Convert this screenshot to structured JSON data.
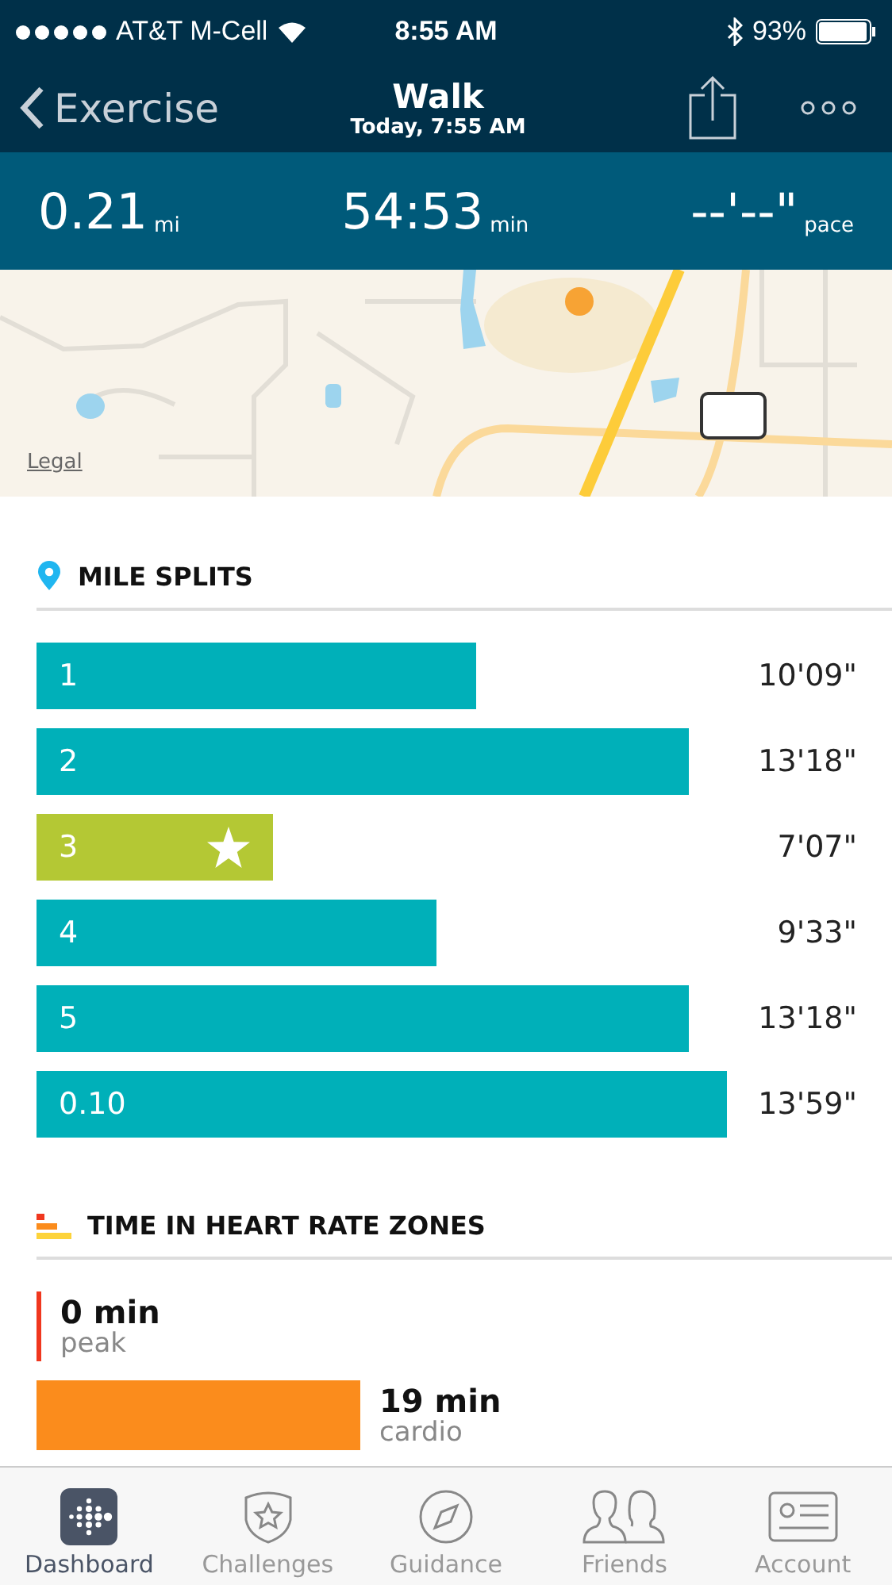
{
  "status_bar": {
    "carrier": "AT&T M-Cell",
    "time": "8:55 AM",
    "battery": "93%"
  },
  "nav": {
    "back": "Exercise",
    "title": "Walk",
    "subtitle": "Today, 7:55 AM"
  },
  "stats": [
    {
      "value": "0.21",
      "unit": "mi"
    },
    {
      "value": "54:53",
      "unit": "min"
    },
    {
      "value": "--'--\"",
      "unit": "pace"
    }
  ],
  "map": {
    "kind": "picture",
    "legal": "Legal"
  },
  "splits": {
    "title": "MILE SPLITS",
    "rows": [
      {
        "label": "1",
        "time": "10'09\"",
        "best": false
      },
      {
        "label": "2",
        "time": "13'18\"",
        "best": false
      },
      {
        "label": "3",
        "time": "7'07\"",
        "best": true
      },
      {
        "label": "4",
        "time": "9'33\"",
        "best": false
      },
      {
        "label": "5",
        "time": "13'18\"",
        "best": false
      },
      {
        "label": "0.10",
        "time": "13'59\"",
        "best": false
      }
    ]
  },
  "heart_zones": {
    "title": "TIME IN HEART RATE ZONES",
    "zones": [
      {
        "value": "0 min",
        "label": "peak",
        "color": "#f0371e"
      },
      {
        "value": "19 min",
        "label": "cardio",
        "color": "#fb8c1c"
      }
    ]
  },
  "tabs": [
    {
      "label": "Dashboard",
      "selected": true
    },
    {
      "label": "Challenges",
      "selected": false
    },
    {
      "label": "Guidance",
      "selected": false
    },
    {
      "label": "Friends",
      "selected": false
    },
    {
      "label": "Account",
      "selected": false
    }
  ]
}
